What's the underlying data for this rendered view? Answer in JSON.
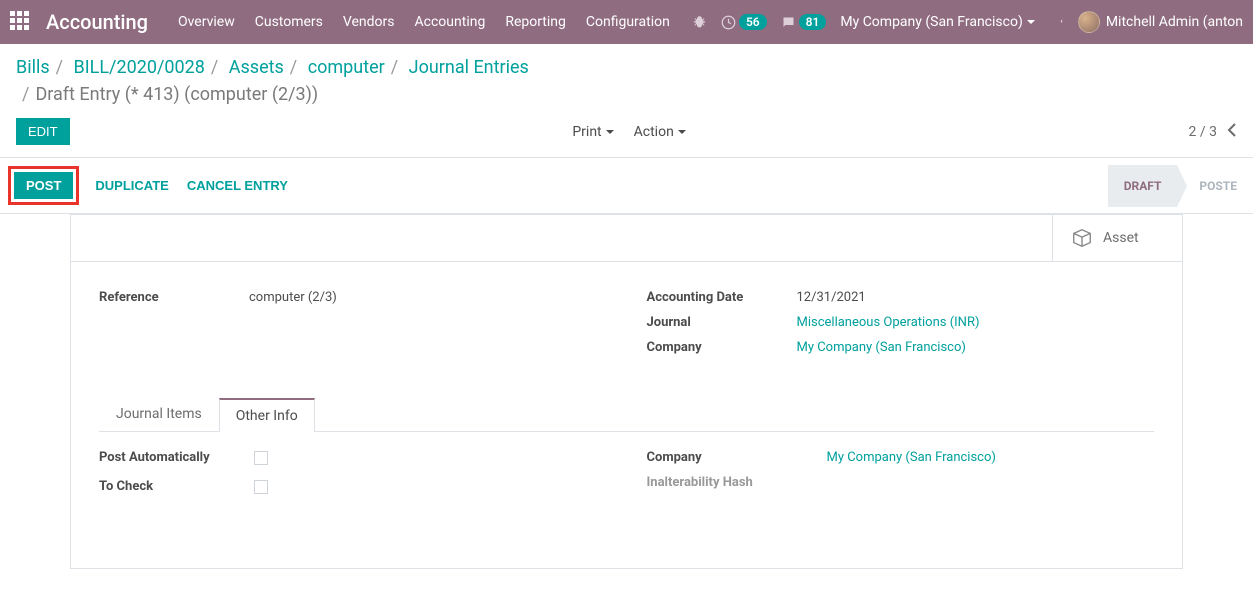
{
  "topnav": {
    "app_title": "Accounting",
    "menu": [
      "Overview",
      "Customers",
      "Vendors",
      "Accounting",
      "Reporting",
      "Configuration"
    ],
    "activity_count": "56",
    "message_count": "81",
    "company": "My Company (San Francisco)",
    "user_name": "Mitchell Admin (anton"
  },
  "breadcrumb": {
    "items": [
      "Bills",
      "BILL/2020/0028",
      "Assets",
      "computer",
      "Journal Entries"
    ],
    "current": "Draft Entry (* 413) (computer (2/3))"
  },
  "actionbar": {
    "edit": "Edit",
    "print": "Print",
    "action": "Action",
    "pager": "2 / 3"
  },
  "statusbar": {
    "post": "Post",
    "duplicate": "Duplicate",
    "cancel": "Cancel Entry",
    "status_active": "Draft",
    "status_next": "Poste"
  },
  "statbox": {
    "asset": "Asset"
  },
  "fields": {
    "left": {
      "reference_label": "Reference",
      "reference_value": "computer (2/3)"
    },
    "right": {
      "acc_date_label": "Accounting Date",
      "acc_date_value": "12/31/2021",
      "journal_label": "Journal",
      "journal_value": "Miscellaneous Operations (INR)",
      "company_label": "Company",
      "company_value": "My Company (San Francisco)"
    }
  },
  "tabs": {
    "items": "Journal Items",
    "other": "Other Info"
  },
  "other_info": {
    "post_auto_label": "Post Automatically",
    "to_check_label": "To Check",
    "company_label": "Company",
    "company_value": "My Company (San Francisco)",
    "inalt_label": "Inalterability Hash"
  }
}
